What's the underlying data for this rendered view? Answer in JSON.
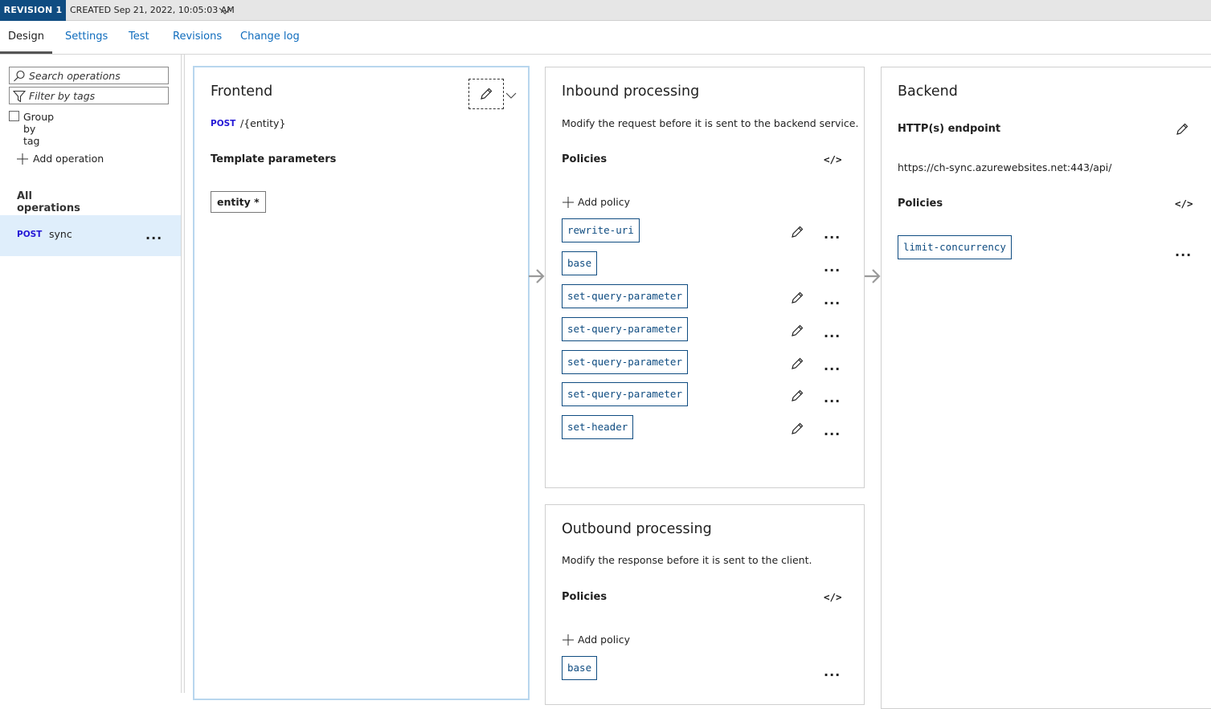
{
  "revision": {
    "badge": "REVISION 1",
    "created": "CREATED Sep 21, 2022, 10:05:03 AM"
  },
  "tabs": [
    {
      "label": "Design",
      "active": true
    },
    {
      "label": "Settings"
    },
    {
      "label": "Test"
    },
    {
      "label": "Revisions"
    },
    {
      "label": "Change log"
    }
  ],
  "sidebar": {
    "search_placeholder": "Search operations",
    "filter_placeholder": "Filter by tags",
    "group_by_tag": "Group by tag",
    "add_operation": "Add operation",
    "all_operations": "All operations",
    "operations": [
      {
        "method": "POST",
        "name": "sync"
      }
    ]
  },
  "frontend": {
    "title": "Frontend",
    "method": "POST",
    "path": "/{entity}",
    "template_params_label": "Template parameters",
    "params": [
      "entity *"
    ]
  },
  "inbound": {
    "title": "Inbound processing",
    "description": "Modify the request before it is sent to the backend service.",
    "policies_label": "Policies",
    "add_policy": "Add policy",
    "policies": [
      "rewrite-uri",
      "base",
      "set-query-parameter",
      "set-query-parameter",
      "set-query-parameter",
      "set-query-parameter",
      "set-header"
    ]
  },
  "outbound": {
    "title": "Outbound processing",
    "description": "Modify the response before it is sent to the client.",
    "policies_label": "Policies",
    "add_policy": "Add policy",
    "policies": [
      "base"
    ]
  },
  "backend": {
    "title": "Backend",
    "endpoint_label": "HTTP(s) endpoint",
    "endpoint_url": "https://ch-sync.azurewebsites.net:443/api/",
    "policies_label": "Policies",
    "policies": [
      "limit-concurrency"
    ]
  },
  "icons": {
    "code": "</>",
    "more": "..."
  },
  "colors": {
    "accent": "#0f4c81",
    "link": "#0f6cbd",
    "method": "#2417d6",
    "selected": "#dfeefb"
  }
}
